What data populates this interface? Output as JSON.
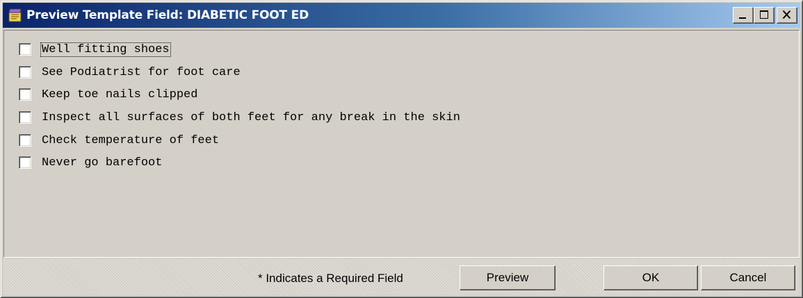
{
  "window": {
    "title": "Preview Template Field: DIABETIC FOOT ED"
  },
  "checklist": {
    "items": [
      {
        "label": "Well fitting shoes",
        "checked": false,
        "focused": true
      },
      {
        "label": "See Podiatrist for foot care",
        "checked": false,
        "focused": false
      },
      {
        "label": "Keep toe nails clipped",
        "checked": false,
        "focused": false
      },
      {
        "label": "Inspect all surfaces of both feet for any break in the skin",
        "checked": false,
        "focused": false
      },
      {
        "label": "Check temperature of feet",
        "checked": false,
        "focused": false
      },
      {
        "label": "Never go barefoot",
        "checked": false,
        "focused": false
      }
    ]
  },
  "footer": {
    "required_note": "* Indicates a Required Field",
    "preview_label": "Preview",
    "ok_label": "OK",
    "cancel_label": "Cancel"
  },
  "icons": {
    "window_icon": "template-notepad-icon",
    "minimize": "minimize-icon",
    "maximize": "maximize-icon",
    "close": "close-icon"
  },
  "colors": {
    "titlebar_start": "#0a246a",
    "titlebar_end": "#a6caf0",
    "face": "#d4d0c8"
  }
}
